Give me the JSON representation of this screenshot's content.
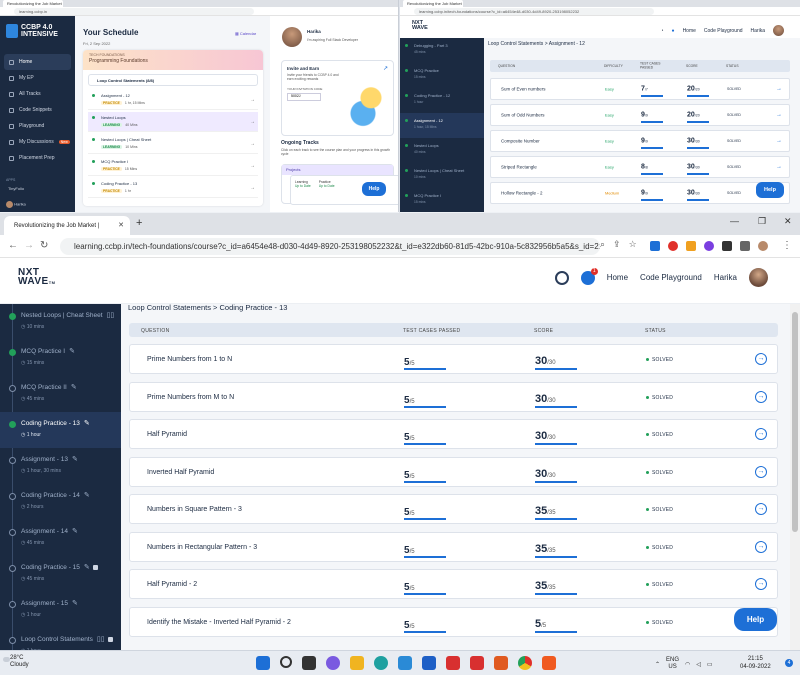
{
  "topLeft": {
    "tab_title": "Revolutionizing the Job Market |",
    "url": "learning.ccbp.in",
    "logo_line1": "CCBP 4.0",
    "logo_line2": "INTENSIVE",
    "nav": [
      {
        "label": "Home"
      },
      {
        "label": "My EP"
      },
      {
        "label": "All Tracks"
      },
      {
        "label": "Code Snippets"
      },
      {
        "label": "Playground"
      },
      {
        "label": "My Discussions"
      },
      {
        "label": "Placement Prep"
      }
    ],
    "new_badge": "New",
    "apps_label": "APPS",
    "tinyfolio": "TinyFolio",
    "user": "Harika",
    "schedule_title": "Your Schedule",
    "schedule_date": "Fri, 2 Sep 2022",
    "calendar_label": "Calendar",
    "banner_small": "TECH FOUNDATIONS",
    "banner_title": "Programming Foundations",
    "topic": "Loop Control Statements (8/8)",
    "items": [
      {
        "title": "Assignment - 12",
        "chip": "PRACTICE",
        "meta": "1 hr, 15 Mins",
        "kind": "practice"
      },
      {
        "title": "Nested Loops",
        "chip": "LEARNING",
        "meta": "40 Mins",
        "kind": "learning"
      },
      {
        "title": "Nested Loops | Cheat Sheet",
        "chip": "LEARNING",
        "meta": "10 Mins",
        "kind": "learning"
      },
      {
        "title": "MCQ Practice I",
        "chip": "PRACTICE",
        "meta": "15 Mins",
        "kind": "practice"
      },
      {
        "title": "Coding Practice - 13",
        "chip": "PRACTICE",
        "meta": "1 hr",
        "kind": "practice"
      }
    ],
    "profile_name": "Harika",
    "profile_role": "I'm aspiring Full Stack Developer",
    "invite_title": "Invite and Earn",
    "invite_text": "Invite your friends to CCBP 4.0 and earn exciting rewards",
    "invite_code_label": "YOUR INVITATION CODE",
    "invite_code": "5002J",
    "tracks_title": "Ongoing Tracks",
    "tracks_text": "Click on each track to see the course plan and your progress in this growth cycle",
    "projects_label": "Projects",
    "learning_label": "Learning",
    "learning_status": "Up to Date",
    "practice_label": "Practice",
    "practice_status": "Up to Date",
    "help": "Help"
  },
  "topRight": {
    "url": "learning.ccbp.in/tech-foundations/course?c_id=a6454e48-d030-4d49-8920-253198052232",
    "logo_line1": "NXT",
    "logo_line2": "WAVE",
    "nav_home": "Home",
    "nav_playground": "Code Playground",
    "user": "Harika",
    "sidebar": [
      {
        "name": "Debugging - Part 3",
        "meta": "45 mins",
        "active": false
      },
      {
        "name": "MCQ Practice",
        "meta": "15 mins",
        "active": false
      },
      {
        "name": "Coding Practice - 12",
        "meta": "1 hour",
        "active": false
      },
      {
        "name": "Assignment - 12",
        "meta": "1 hour, 15 Mins",
        "active": true
      },
      {
        "name": "Nested Loops",
        "meta": "40 mins",
        "active": false
      },
      {
        "name": "Nested Loops | Cheat Sheet",
        "meta": "10 mins",
        "active": false
      },
      {
        "name": "MCQ Practice I",
        "meta": "15 mins",
        "active": false
      }
    ],
    "breadcrumb": "Loop Control Statements > Assignment - 12",
    "headers": {
      "question": "QUESTION",
      "difficulty": "DIFFICULTY",
      "tests": "TEST CASES PASSED",
      "score": "SCORE",
      "status": "STATUS"
    },
    "rows": [
      {
        "q": "Sum of Even numbers",
        "diff": "Easy",
        "tc": "7",
        "tct": "/7",
        "sc": "20",
        "sct": "/20",
        "status": "SOLVED"
      },
      {
        "q": "Sum of Odd Numbers",
        "diff": "Easy",
        "tc": "9",
        "tct": "/9",
        "sc": "20",
        "sct": "/20",
        "status": "SOLVED"
      },
      {
        "q": "Composite Number",
        "diff": "Easy",
        "tc": "9",
        "tct": "/9",
        "sc": "30",
        "sct": "/30",
        "status": "SOLVED"
      },
      {
        "q": "Striped Rectangle",
        "diff": "Easy",
        "tc": "8",
        "tct": "/8",
        "sc": "30",
        "sct": "/30",
        "status": "SOLVED"
      },
      {
        "q": "Hollow Rectangle - 2",
        "diff": "Medium",
        "tc": "9",
        "tct": "/9",
        "sc": "30",
        "sct": "/30",
        "status": "SOLVED"
      }
    ],
    "help": "Help"
  },
  "main": {
    "tab_title": "Revolutionizing the Job Market |",
    "url": "learning.ccbp.in/tech-foundations/course?c_id=a6454e48-d030-4d49-8920-253198052232&t_id=e322db60-81d5-42bc-910a-5c832956b5a5&s_id=21b27...",
    "logo_line1": "NXT",
    "logo_line2": "WAVE",
    "logo_tm": "TM",
    "notif_count": "1",
    "nav_home": "Home",
    "nav_playground": "Code Playground",
    "user": "Harika",
    "sidebar": [
      {
        "name": "Nested Loops | Cheat Sheet",
        "meta": "10 mins",
        "done": true,
        "icon": "book",
        "lock": false,
        "active": false
      },
      {
        "name": "MCQ Practice I",
        "meta": "15 mins",
        "done": true,
        "icon": "edit",
        "lock": false,
        "active": false
      },
      {
        "name": "MCQ Practice II",
        "meta": "45 mins",
        "done": false,
        "icon": "edit",
        "lock": false,
        "active": false
      },
      {
        "name": "Coding Practice - 13",
        "meta": "1 hour",
        "done": true,
        "icon": "edit",
        "lock": false,
        "active": true
      },
      {
        "name": "Assignment - 13",
        "meta": "1 hour, 30 mins",
        "done": false,
        "icon": "edit",
        "lock": false,
        "active": false
      },
      {
        "name": "Coding Practice - 14",
        "meta": "2 hours",
        "done": false,
        "icon": "edit",
        "lock": false,
        "active": false
      },
      {
        "name": "Assignment - 14",
        "meta": "45 mins",
        "done": false,
        "icon": "edit",
        "lock": false,
        "active": false
      },
      {
        "name": "Coding Practice - 15",
        "meta": "45 mins",
        "done": false,
        "icon": "edit",
        "lock": true,
        "active": false
      },
      {
        "name": "Assignment - 15",
        "meta": "1 hour",
        "done": false,
        "icon": "edit",
        "lock": false,
        "active": false
      },
      {
        "name": "Loop Control Statements",
        "meta": "1 hour",
        "done": false,
        "icon": "book",
        "lock": true,
        "active": false
      }
    ],
    "breadcrumb": "Loop Control Statements > Coding Practice - 13",
    "headers": {
      "question": "QUESTION",
      "tests": "TEST CASES PASSED",
      "score": "SCORE",
      "status": "STATUS"
    },
    "rows": [
      {
        "q": "Prime Numbers from 1 to N",
        "tc": "5",
        "tct": "/5",
        "sc": "30",
        "sct": "/30",
        "status": "SOLVED"
      },
      {
        "q": "Prime Numbers from M to N",
        "tc": "5",
        "tct": "/5",
        "sc": "30",
        "sct": "/30",
        "status": "SOLVED"
      },
      {
        "q": "Half Pyramid",
        "tc": "5",
        "tct": "/5",
        "sc": "30",
        "sct": "/30",
        "status": "SOLVED"
      },
      {
        "q": "Inverted Half Pyramid",
        "tc": "5",
        "tct": "/5",
        "sc": "30",
        "sct": "/30",
        "status": "SOLVED"
      },
      {
        "q": "Numbers in Square Pattern - 3",
        "tc": "5",
        "tct": "/5",
        "sc": "35",
        "sct": "/35",
        "status": "SOLVED"
      },
      {
        "q": "Numbers in Rectangular Pattern - 3",
        "tc": "5",
        "tct": "/5",
        "sc": "35",
        "sct": "/35",
        "status": "SOLVED"
      },
      {
        "q": "Half Pyramid - 2",
        "tc": "5",
        "tct": "/5",
        "sc": "35",
        "sct": "/35",
        "status": "SOLVED"
      },
      {
        "q": "Identify the Mistake - Inverted Half Pyramid - 2",
        "tc": "5",
        "tct": "/5",
        "sc": "5",
        "sct": "/5",
        "status": "SOLVED"
      }
    ],
    "help": "Help"
  },
  "taskbar": {
    "temp": "28°C",
    "weather": "Cloudy",
    "lang1": "ENG",
    "lang2": "US",
    "time": "21:15",
    "date": "04-09-2022",
    "notif": "4",
    "mini_temp": "28°C",
    "mini_weather": "Cloudy",
    "mini_time": "21:14",
    "mini_date": "04-09-2022"
  },
  "colors": {
    "accent": "#1d6fd6",
    "sidebar": "#1b2a41",
    "solved": "#22a05a"
  }
}
